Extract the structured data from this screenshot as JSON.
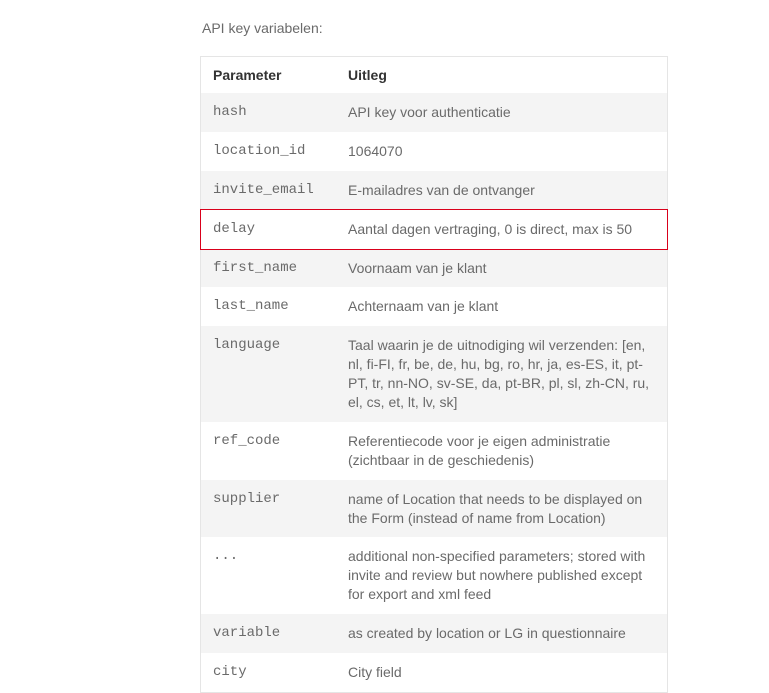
{
  "intro": "API key variabelen:",
  "headers": {
    "param": "Parameter",
    "uitleg": "Uitleg"
  },
  "rows": [
    {
      "param": "hash",
      "uitleg": "API key voor authenticatie",
      "highlight": false
    },
    {
      "param": "location_id",
      "uitleg": "1064070",
      "highlight": false
    },
    {
      "param": "invite_email",
      "uitleg": "E-mailadres van de ontvanger",
      "highlight": false
    },
    {
      "param": "delay",
      "uitleg": "Aantal dagen vertraging, 0 is direct, max is 50",
      "highlight": true
    },
    {
      "param": "first_name",
      "uitleg": "Voornaam van je klant",
      "highlight": false
    },
    {
      "param": "last_name",
      "uitleg": "Achternaam van je klant",
      "highlight": false
    },
    {
      "param": "language",
      "uitleg": "Taal waarin je de uitnodiging wil verzenden: [en, nl, fi-FI, fr, be, de, hu, bg, ro, hr, ja, es-ES, it, pt-PT, tr, nn-NO, sv-SE, da, pt-BR, pl, sl, zh-CN, ru, el, cs, et, lt, lv, sk]",
      "highlight": false
    },
    {
      "param": "ref_code",
      "uitleg": "Referentiecode voor je eigen administratie (zichtbaar in de geschiedenis)",
      "highlight": false
    },
    {
      "param": "supplier",
      "uitleg": "name of Location that needs to be displayed on the Form (instead of name from Location)",
      "highlight": false
    },
    {
      "param": "...",
      "uitleg": "additional non-specified parameters; stored with invite and review but nowhere published except for export and xml feed",
      "highlight": false
    },
    {
      "param": "variable",
      "uitleg": "as created by location or LG in questionnaire",
      "highlight": false
    },
    {
      "param": "city",
      "uitleg": "City field",
      "highlight": false
    }
  ]
}
